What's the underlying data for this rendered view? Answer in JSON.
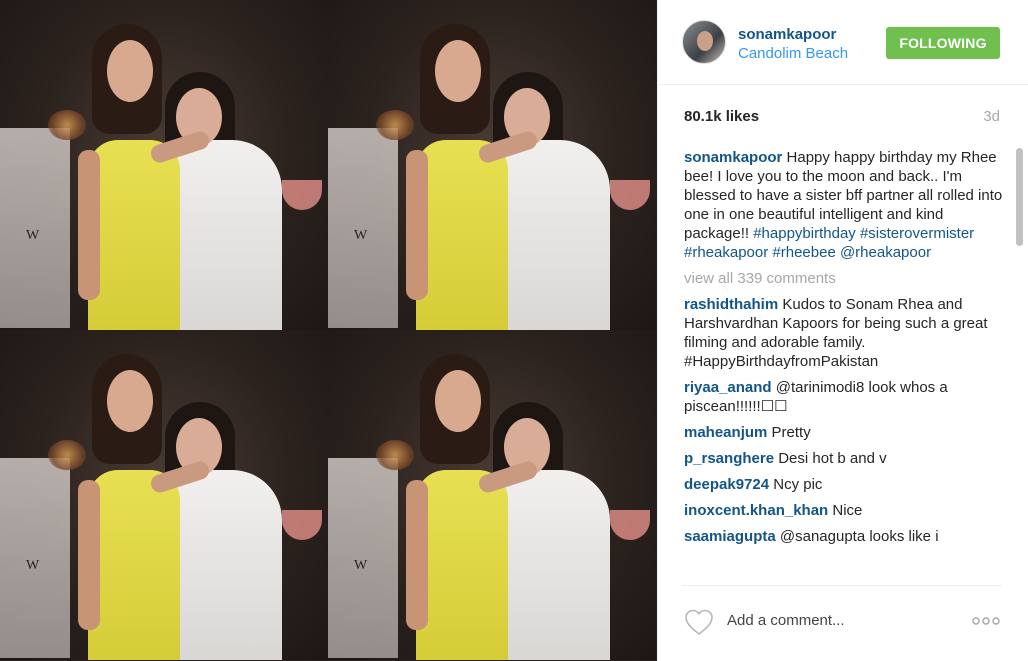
{
  "post": {
    "username": "sonamkapoor",
    "location": "Candolim Beach",
    "follow_label": "FOLLOWING",
    "likes": "80.1k likes",
    "time": "3d",
    "caption": {
      "author": "sonamkapoor",
      "text": "Happy happy birthday my Rhee bee! I love you to the moon and back.. I'm blessed to have a sister bff partner all rolled into one in one beautiful intelligent and kind package!!",
      "tags": "#happybirthday #sisterovermister #rheakapoor #rheebee @rheakapoor"
    },
    "view_all": "view all 339 comments",
    "comments": [
      {
        "author": "rashidthahim",
        "text": "Kudos to Sonam Rhea and Harshvardhan Kapoors for being such a great filming and adorable family. #HappyBirthdayfromPakistan"
      },
      {
        "author": "riyaa_anand",
        "text": "@tarinimodi8 look whos a piscean!!!!!!☐☐"
      },
      {
        "author": "maheanjum",
        "text": "Pretty"
      },
      {
        "author": "p_rsanghere",
        "text": "Desi hot b and v"
      },
      {
        "author": "deepak9724",
        "text": "Ncy pic"
      },
      {
        "author": "inoxcent.khan_khan",
        "text": "Nice"
      },
      {
        "author": "saamiagupta",
        "text": "@sanagupta looks like i"
      }
    ],
    "add_comment_placeholder": "Add a comment..."
  },
  "icons": {
    "heart": "heart-icon",
    "more": "more-options-icon"
  },
  "colors": {
    "follow_green": "#70c050",
    "username_blue": "#125688",
    "location_blue": "#3897f0",
    "muted_gray": "#a5a7aa"
  }
}
